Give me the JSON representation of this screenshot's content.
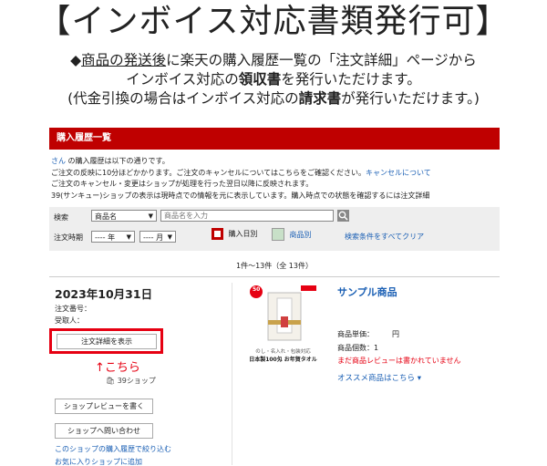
{
  "banner": {
    "title": "【インボイス対応書類発行可】",
    "line1_pre": "◆",
    "line1_u": "商品の発送後",
    "line1_post": "に楽天の購入履歴一覧の「注文詳細」ページから",
    "line2_pre": "インボイス対応の",
    "line2_bold": "領収書",
    "line2_post": "を発行いただけます。",
    "line3_pre": "(代金引換の場合はインボイス対応の",
    "line3_bold": "請求書",
    "line3_post": "が発行いただけます。)"
  },
  "history": {
    "header": "購入履歴一覧",
    "greet_link": "さん",
    "greet_text": "の購入履歴は以下の通りです。",
    "info1": "ご注文の反映に10分ほどかかります。ご注文のキャンセルについてはこちらをご確認ください。",
    "info1_link": "キャンセルについて",
    "info2": "ご注文のキャンセル・変更はショップが処理を行った翌日以降に反映されます。",
    "info3": "39(サンキュー)ショップの表示は現時点での情報を元に表示しています。購入時点での状態を確認するには注文詳細",
    "search": {
      "label": "検索",
      "field_select": "商品名",
      "placeholder": "商品名を入力",
      "period_label": "注文時期",
      "year_select": "---- 年",
      "month_select": "---- 月",
      "by_date": "購入日別",
      "by_product": "商品別",
      "clear_link": "検索条件をすべてクリア"
    },
    "count_text": "1件〜13件（全 13件）",
    "order": {
      "date": "2023年10月31日",
      "order_no_label": "注文番号：",
      "recipient_label": "受取人：",
      "detail_button": "注文詳細を表示",
      "arrow_note": "↑こちら",
      "shop_badge": "39ショップ",
      "review_button": "ショップレビューを書く",
      "contact_button": "ショップへ問い合わせ",
      "shop_history_link": "このショップの購入履歴で絞り込む",
      "favorite_link": "お気に入りショップに追加"
    },
    "product": {
      "title": "サンプル商品",
      "badge_number": "50",
      "image_caption1": "のし・名入れ・包装対応",
      "image_caption2": "日本製100匁 お年賀タオル",
      "unit_price_label": "商品単価：",
      "unit_price_value": "円",
      "qty_label": "商品個数：",
      "qty_value": "1",
      "review_note": "まだ商品レビューは書かれていません",
      "recommend_link": "オススメ商品はこちら ▾"
    }
  }
}
